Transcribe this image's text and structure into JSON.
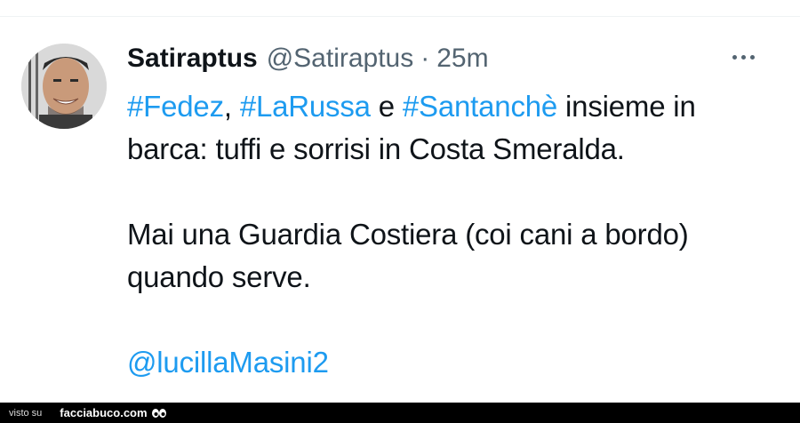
{
  "tweet": {
    "display_name": "Satiraptus",
    "handle": "@Satiraptus",
    "separator": "·",
    "timestamp": "25m",
    "avatar_icon": "user-avatar-photo",
    "more_icon": "more-options-icon",
    "line1": {
      "hashtag1": "#Fedez",
      "comma": ",",
      "hashtag2": "#LaRussa",
      "conj": " e ",
      "hashtag3": "#Santanchè",
      "rest": " insieme in"
    },
    "line2": "barca: tuffi e sorrisi in Costa Smeralda.",
    "line3": "Mai una Guardia Costiera (coi cani a bordo)",
    "line4": "quando serve.",
    "mention": "@lucillaMasini2"
  },
  "footer": {
    "visto_label": "visto su",
    "brand_label": "facciabuco.com",
    "eyes_icon": "eyes-icon"
  },
  "colors": {
    "link": "#1d9bf0",
    "text": "#0f1419",
    "secondary": "#536471",
    "footer_bg": "#000000"
  }
}
